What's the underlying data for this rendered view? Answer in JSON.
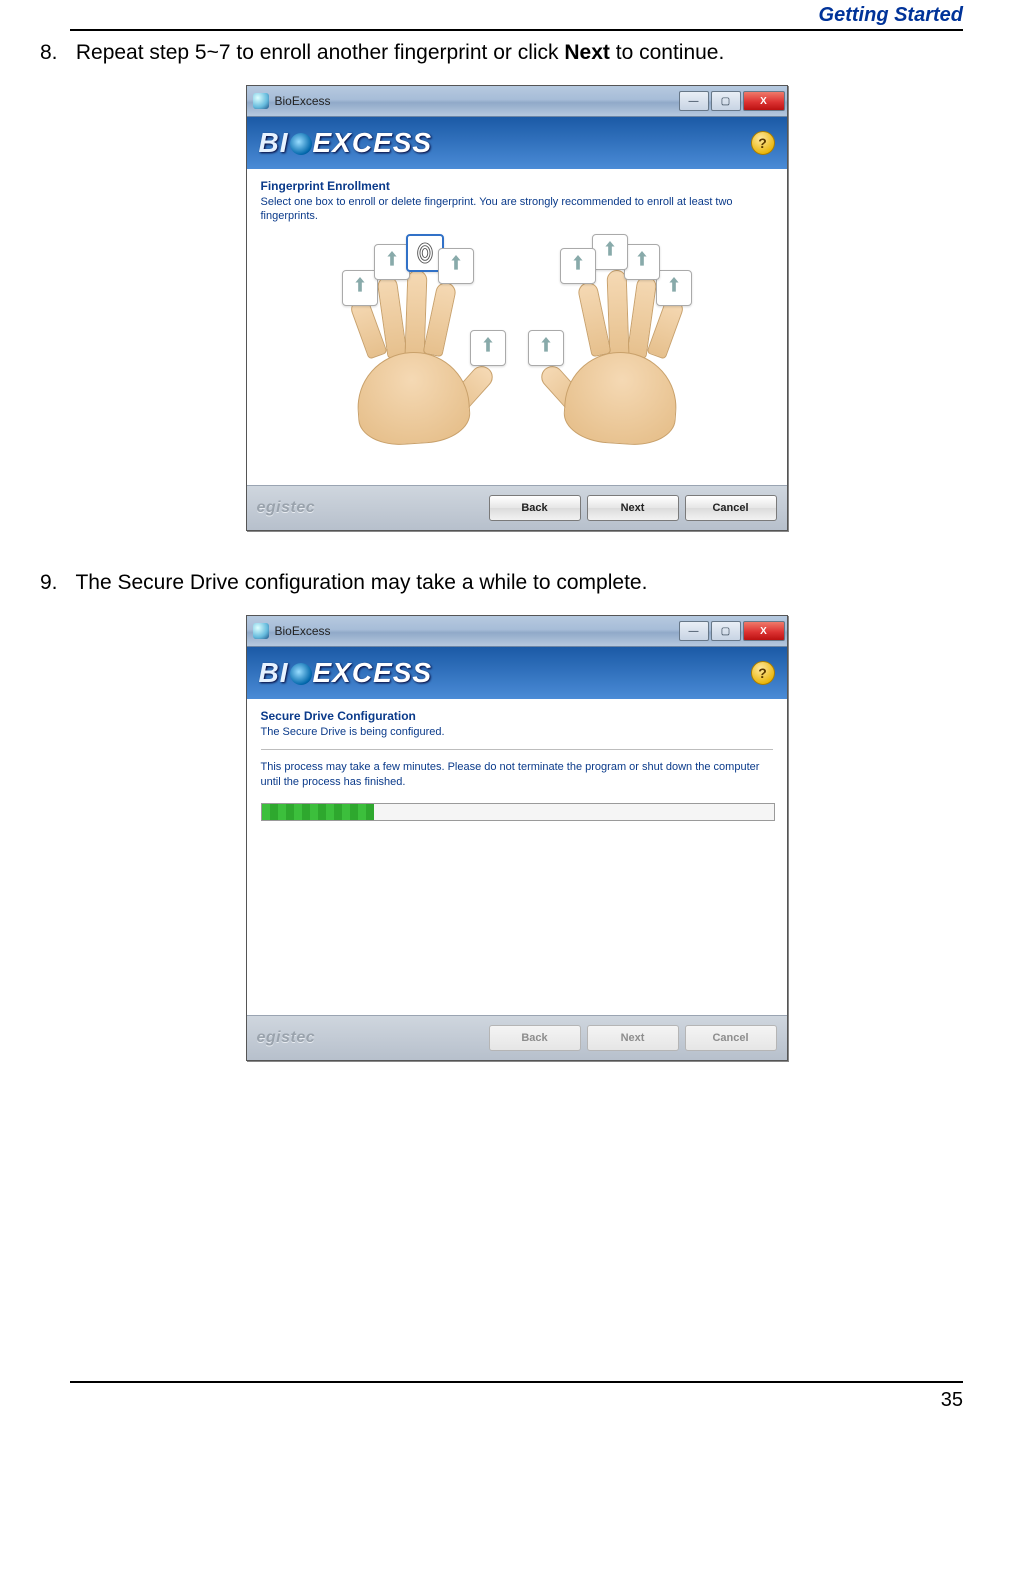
{
  "page_header": "Getting Started",
  "page_number": "35",
  "steps": {
    "step8": {
      "num": "8.",
      "text_a": "Repeat step 5~7 to enroll another fingerprint or click ",
      "bold": "Next",
      "text_b": " to continue."
    },
    "step9": {
      "num": "9.",
      "text": "The Secure Drive configuration may take a while to complete."
    }
  },
  "dialog1": {
    "window_title": "BioExcess",
    "brand_bi": "BI",
    "brand_rest": "EXCESS",
    "help_glyph": "?",
    "section_title": "Fingerprint Enrollment",
    "section_sub": "Select one box to enroll or delete fingerprint. You are strongly recommended to enroll at least two fingerprints.",
    "footer_brand": "egistec",
    "buttons": {
      "back": "Back",
      "next": "Next",
      "cancel": "Cancel"
    },
    "win": {
      "min": "—",
      "max": "▢",
      "close": "X"
    }
  },
  "dialog2": {
    "window_title": "BioExcess",
    "brand_bi": "BI",
    "brand_rest": "EXCESS",
    "help_glyph": "?",
    "section_title": "Secure Drive Configuration",
    "section_sub": "The Secure Drive is being configured.",
    "info": "This process may take a few minutes. Please do not terminate the program or shut down the computer until the process has finished.",
    "progress_pct": 22,
    "footer_brand": "egistec",
    "buttons": {
      "back": "Back",
      "next": "Next",
      "cancel": "Cancel"
    },
    "win": {
      "min": "—",
      "max": "▢",
      "close": "X"
    }
  }
}
